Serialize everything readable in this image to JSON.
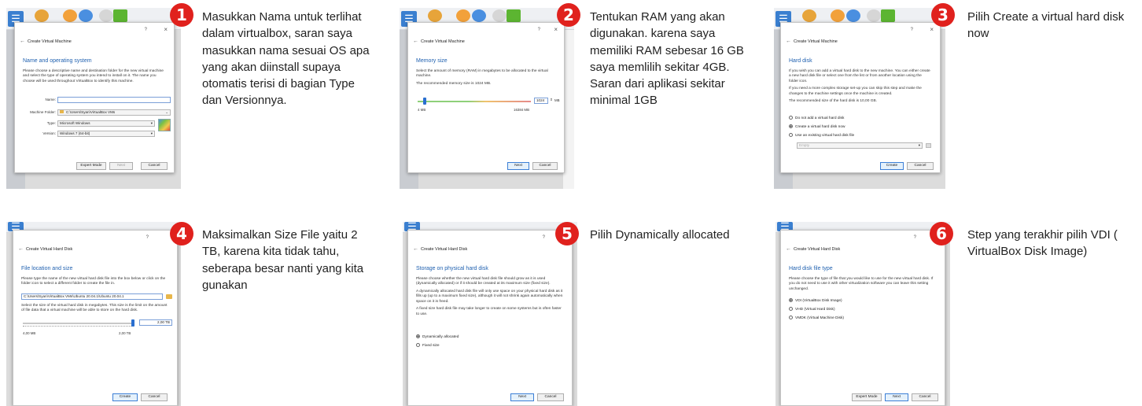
{
  "toolbar": {
    "menu_glyph": "☰",
    "preferences": "Preferences",
    "import": "Import",
    "export": "Export",
    "new": "New",
    "add": "Add"
  },
  "common": {
    "help": "?",
    "close": "×",
    "back": "←",
    "next": "Next",
    "cancel": "Cancel",
    "create": "Create",
    "expert_mode": "Expert Mode"
  },
  "steps": [
    {
      "number": "1",
      "description": "Masukkan  Nama untuk terlihat dalam virtualbox, saran saya masukkan nama sesuai OS apa yang akan diinstall supaya otomatis terisi di bagian Type dan Versionnya.",
      "window_title": "Create Virtual Machine",
      "heading": "Name and operating system",
      "intro": "Please choose a descriptive name and destination folder for the new virtual machine and select the type of operating system you intend to install on it. The name you choose will be used throughout VirtualBox to identify this machine.",
      "name_label": "Name:",
      "name_value": "",
      "folder_label": "Machine Folder:",
      "folder_value": "C:\\Users\\Syan\\VirtualBox VMs",
      "type_label": "Type:",
      "type_value": "Microsoft Windows",
      "version_label": "Version:",
      "version_value": "Windows 7 (64-bit)"
    },
    {
      "number": "2",
      "description": "Tentukan RAM yang akan digunakan. karena saya memiliki RAM sebesar 16 GB saya memlilih sekitar 4GB. Saran dari aplikasi sekitar minimal 1GB",
      "window_title": "Create Virtual Machine",
      "heading": "Memory size",
      "intro": "Select the amount of memory (RAM) in megabytes to be allocated to the virtual machine.",
      "recommended": "The recommended memory size is 1024 MB.",
      "memory_value": "1024",
      "unit": "MB",
      "min_label": "4 MB",
      "max_label": "16384 MB",
      "slider_fraction": 0.06
    },
    {
      "number": "3",
      "description": "Pilih Create a virtual hard disk now",
      "window_title": "Create Virtual Machine",
      "heading": "Hard disk",
      "intro1": "If you wish you can add a virtual hard disk to the new machine. You can either create a new hard disk file or select one from the list or from another location using the folder icon.",
      "intro2": "If you need a more complex storage set-up you can skip this step and make the changes to the machine settings once the machine is created.",
      "recommended": "The recommended size of the hard disk is 10,00 GB.",
      "options": [
        "Do not add a virtual hard disk",
        "Create a virtual hard disk now",
        "Use an existing virtual hard disk file"
      ],
      "selected": 1,
      "existing_value": "Empty"
    },
    {
      "number": "4",
      "description": "Maksimalkan Size File yaitu 2 TB, karena kita tidak tahu, seberapa besar nanti yang kita gunakan",
      "window_title": "Create Virtual Hard Disk",
      "heading": "File location and size",
      "intro1": "Please type the name of the new virtual hard disk file into the box below or click on the folder icon to select a different folder to create the file in.",
      "path_value": "C:\\Users\\Syan\\VirtualBox VMs\\Ubuntu 20.04.1\\Ubuntu 20.04.1",
      "intro2": "Select the size of the virtual hard disk in megabytes. This size is the limit on the amount of file data that a virtual machine will be able to store on the hard disk.",
      "size_value": "2,00 TB",
      "min_label": "4,00 MB",
      "max_label": "2,00 TB",
      "slider_fraction": 1.0
    },
    {
      "number": "5",
      "description": "Pilih Dynamically allocated",
      "window_title": "Create Virtual Hard Disk",
      "heading": "Storage on physical hard disk",
      "intro1": "Please choose whether the new virtual hard disk file should grow as it is used (dynamically allocated) or if it should be created at its maximum size (fixed size).",
      "intro2": "A dynamically allocated hard disk file will only use space on your physical hard disk as it fills up (up to a maximum fixed size), although it will not shrink again automatically when space on it is freed.",
      "intro3": "A fixed size hard disk file may take longer to create on some systems but is often faster to use.",
      "options": [
        "Dynamically allocated",
        "Fixed size"
      ],
      "selected": 0
    },
    {
      "number": "6",
      "description": "Step yang terakhir pilih VDI ( VirtualBox Disk Image)",
      "window_title": "Create Virtual Hard Disk",
      "heading": "Hard disk file type",
      "intro": "Please choose the type of file that you would like to use for the new virtual hard disk. If you do not need to use it with other virtualization software you can leave this setting unchanged.",
      "options": [
        "VDI (VirtualBox Disk Image)",
        "VHD (Virtual Hard Disk)",
        "VMDK (Virtual Machine Disk)"
      ],
      "selected": 0
    }
  ],
  "colors": {
    "badge": "#e0211d",
    "heading": "#2061b0",
    "accent": "#2a6fd0"
  }
}
